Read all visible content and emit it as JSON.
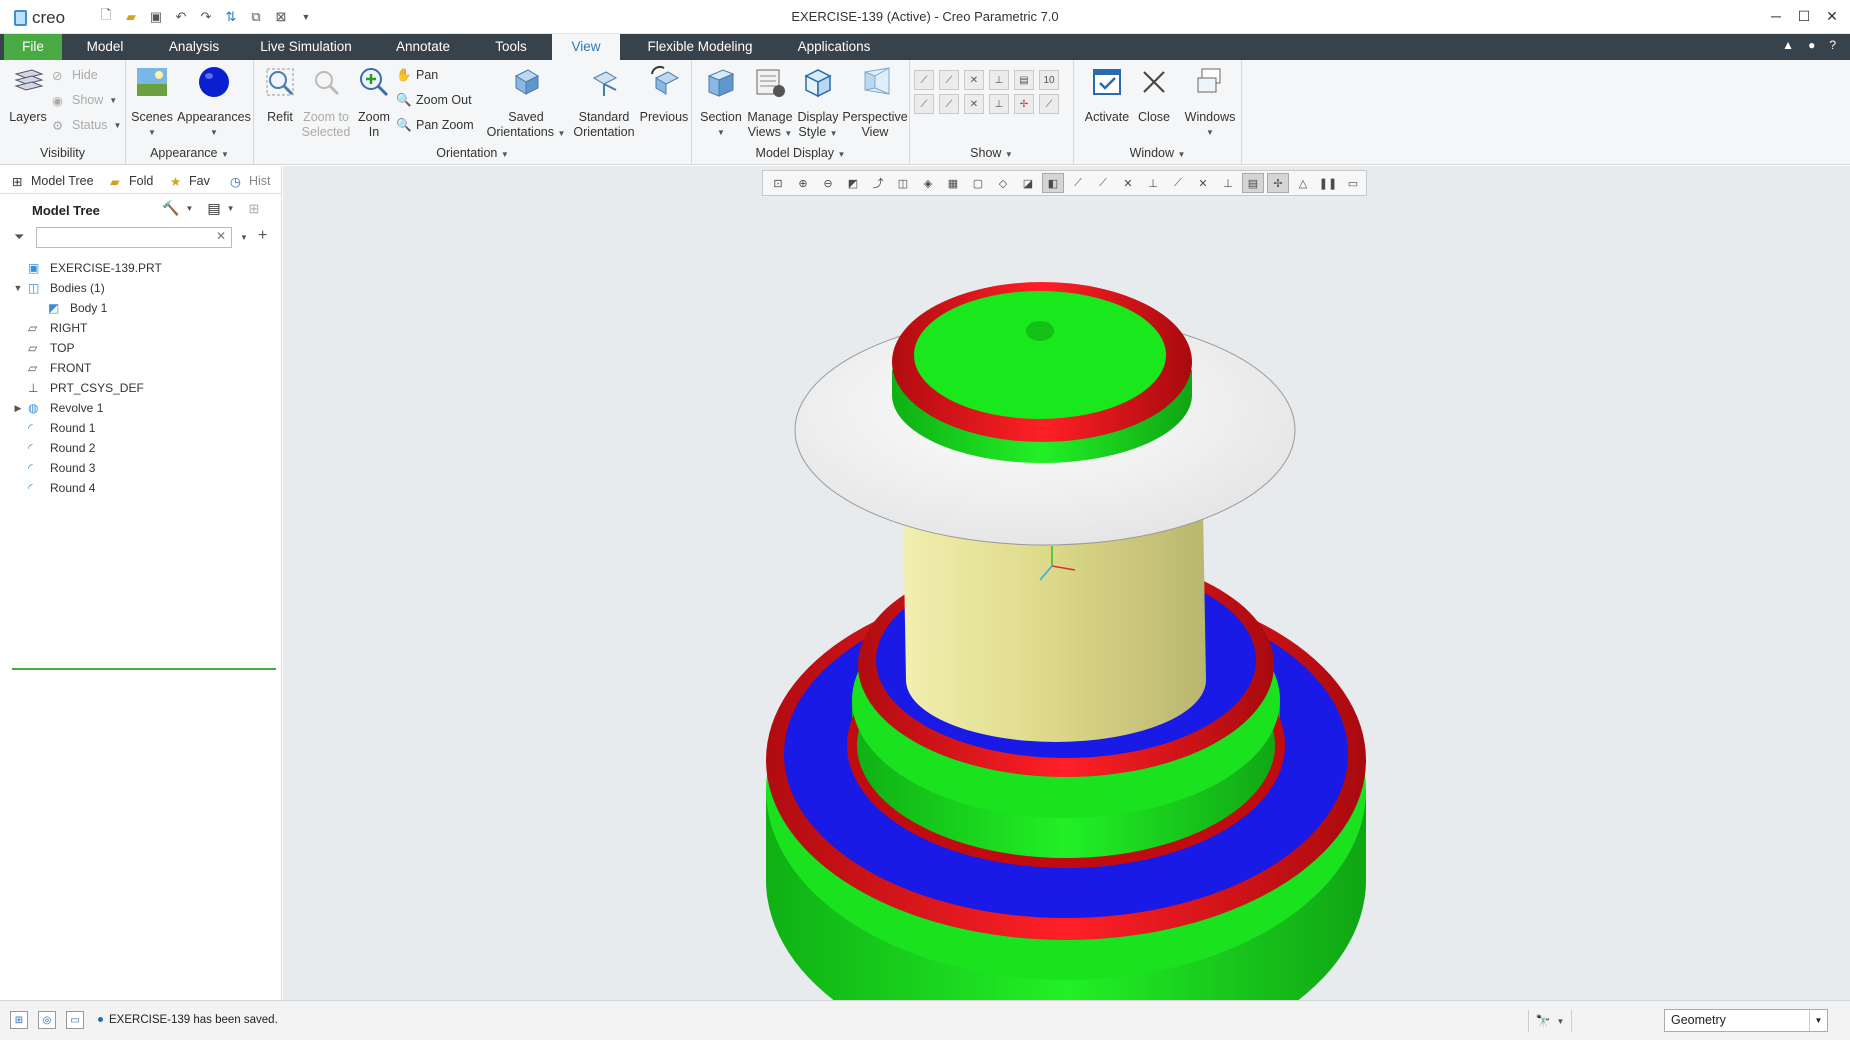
{
  "app": {
    "logo_text": "creo",
    "window_title": "EXERCISE-139 (Active) - Creo Parametric 7.0",
    "window_controls": [
      "minimize-icon",
      "maximize-icon",
      "close-icon"
    ]
  },
  "quick_access": [
    "new-file-icon",
    "open-folder-icon",
    "save-icon",
    "undo-icon",
    "redo-icon",
    "regenerate-icon",
    "windows-icon",
    "close-window-icon",
    "customize-icon"
  ],
  "ribbon_tabs": [
    "File",
    "Model",
    "Analysis",
    "Live Simulation",
    "Annotate",
    "Tools",
    "View",
    "Flexible Modeling",
    "Applications"
  ],
  "active_tab": "View",
  "ribbon": {
    "visibility": {
      "label": "Visibility",
      "layers": "Layers",
      "hide": "Hide",
      "show": "Show",
      "status": "Status"
    },
    "appearance": {
      "label": "Appearance",
      "scenes": "Scenes",
      "appearances": "Appearances"
    },
    "orientation": {
      "label": "Orientation",
      "refit": "Refit",
      "zoom_to_selected_1": "Zoom to",
      "zoom_to_selected_2": "Selected",
      "zoom_in_1": "Zoom",
      "zoom_in_2": "In",
      "pan": "Pan",
      "zoom_out": "Zoom Out",
      "pan_zoom": "Pan Zoom",
      "saved_orientations_1": "Saved",
      "saved_orientations_2": "Orientations",
      "standard_orientation_1": "Standard",
      "standard_orientation_2": "Orientation",
      "previous": "Previous"
    },
    "model_display": {
      "label": "Model Display",
      "section": "Section",
      "manage_views_1": "Manage",
      "manage_views_2": "Views",
      "display_style_1": "Display",
      "display_style_2": "Style",
      "perspective_view_1": "Perspective",
      "perspective_view_2": "View"
    },
    "show": {
      "label": "Show"
    },
    "window": {
      "label": "Window",
      "activate": "Activate",
      "close": "Close",
      "windows": "Windows"
    }
  },
  "panel": {
    "tabs": [
      "Model Tree",
      "Fold",
      "Fav",
      "Hist"
    ],
    "tree_title": "Model Tree",
    "search_value": "",
    "tree": [
      {
        "label": "EXERCISE-139.PRT",
        "icon": "part-icon",
        "level": 0,
        "expander": ""
      },
      {
        "label": "Bodies (1)",
        "icon": "bodies-icon",
        "level": 0,
        "expander": "▼"
      },
      {
        "label": "Body 1",
        "icon": "body-icon",
        "level": 1,
        "expander": ""
      },
      {
        "label": "RIGHT",
        "icon": "datum-plane-icon",
        "level": 0,
        "expander": ""
      },
      {
        "label": "TOP",
        "icon": "datum-plane-icon",
        "level": 0,
        "expander": ""
      },
      {
        "label": "FRONT",
        "icon": "datum-plane-icon",
        "level": 0,
        "expander": ""
      },
      {
        "label": "PRT_CSYS_DEF",
        "icon": "csys-icon",
        "level": 0,
        "expander": ""
      },
      {
        "label": "Revolve 1",
        "icon": "revolve-icon",
        "level": 0,
        "expander": "▶"
      },
      {
        "label": "Round 1",
        "icon": "round-icon",
        "level": 0,
        "expander": ""
      },
      {
        "label": "Round 2",
        "icon": "round-icon",
        "level": 0,
        "expander": ""
      },
      {
        "label": "Round 3",
        "icon": "round-icon",
        "level": 0,
        "expander": ""
      },
      {
        "label": "Round 4",
        "icon": "round-icon",
        "level": 0,
        "expander": ""
      }
    ]
  },
  "colors": {
    "ribbon_dark": "#38424a",
    "file_tab": "#49a942",
    "viewport_bg": "#e8ebee",
    "model_green": "#16e61b",
    "model_red": "#e8161b",
    "model_blue": "#1a1ae6",
    "model_white": "#f4f4f4",
    "model_yellow": "#e3e08e"
  },
  "status": {
    "message": "EXERCISE-139 has been saved.",
    "selection_filter": "Geometry"
  }
}
